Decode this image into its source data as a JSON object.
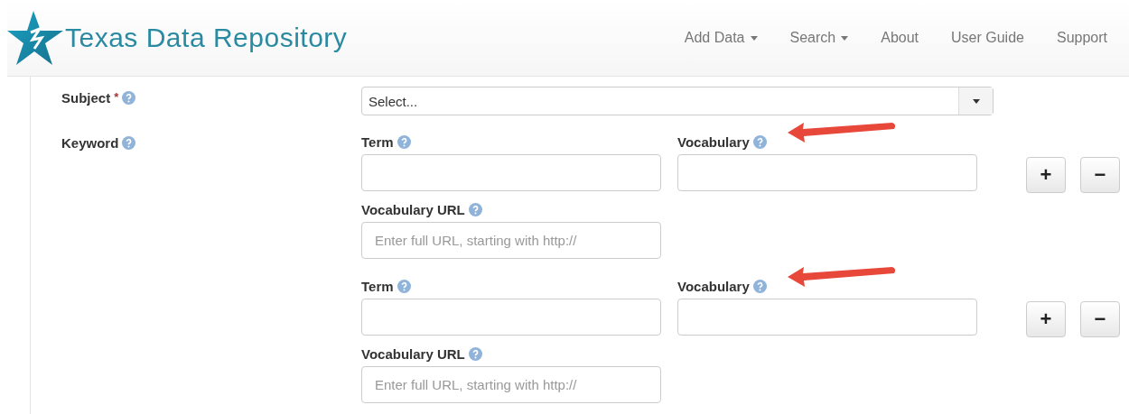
{
  "header": {
    "title": "Texas Data Repository",
    "nav": [
      {
        "label": "Add Data",
        "dropdown": true
      },
      {
        "label": "Search",
        "dropdown": true
      },
      {
        "label": "About",
        "dropdown": false
      },
      {
        "label": "User Guide",
        "dropdown": false
      },
      {
        "label": "Support",
        "dropdown": false
      }
    ]
  },
  "subject": {
    "label": "Subject",
    "required_mark": "*",
    "placeholder": "Select..."
  },
  "keyword": {
    "label": "Keyword",
    "entries": [
      {
        "term_label": "Term",
        "vocabulary_label": "Vocabulary",
        "url_label": "Vocabulary URL",
        "url_placeholder": "Enter full URL, starting with http://",
        "add_button": "+",
        "remove_button": "−",
        "annotated": true
      },
      {
        "term_label": "Term",
        "vocabulary_label": "Vocabulary",
        "url_label": "Vocabulary URL",
        "url_placeholder": "Enter full URL, starting with http://",
        "add_button": "+",
        "remove_button": "−",
        "annotated": true
      }
    ]
  }
}
